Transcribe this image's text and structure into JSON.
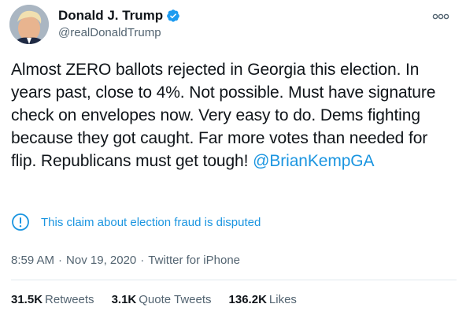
{
  "author": {
    "display_name": "Donald J. Trump",
    "handle": "@realDonaldTrump",
    "verified": true,
    "avatar_icon": "profile-photo"
  },
  "more_icon": "more-dots-icon",
  "tweet": {
    "text": "Almost ZERO ballots rejected in Georgia this election. In years past, close to 4%. Not possible. Must have signature check on envelopes now. Very easy to do. Dems fighting because they got caught. Far more votes than needed for flip. Republicans must get tough! ",
    "mention": "@BrianKempGA"
  },
  "dispute_notice": {
    "icon": "exclamation-circle-icon",
    "text": "This claim about election fraud is disputed"
  },
  "meta": {
    "time": "8:59 AM",
    "separator": "·",
    "date": "Nov 19, 2020",
    "source": "Twitter for iPhone"
  },
  "stats": {
    "retweets_count": "31.5K",
    "retweets_label": "Retweets",
    "quotes_count": "3.1K",
    "quotes_label": "Quote Tweets",
    "likes_count": "136.2K",
    "likes_label": "Likes"
  },
  "colors": {
    "link": "#1b95e0",
    "verified_badge": "#1d9bf0",
    "secondary_text": "#536471"
  }
}
